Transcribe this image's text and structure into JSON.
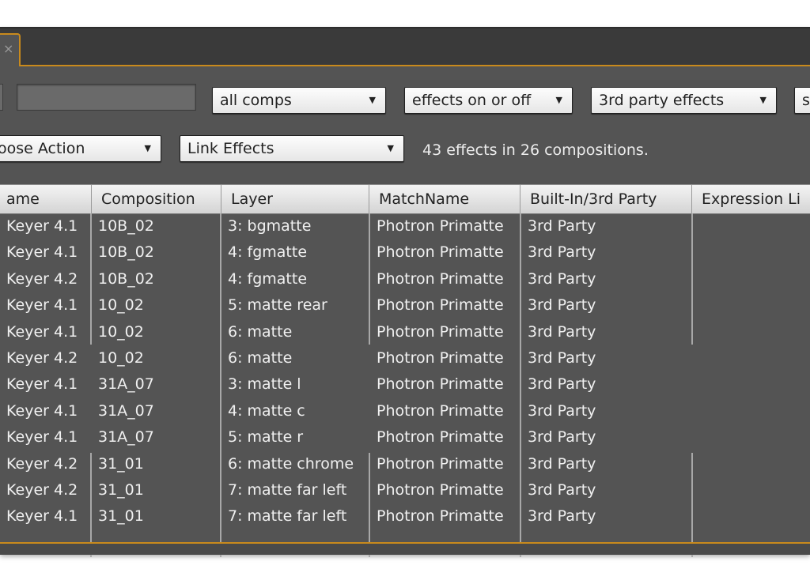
{
  "tab": {
    "close_glyph": "×"
  },
  "toolbar": {
    "search_value": "",
    "comp_filter": "all comps",
    "effects_state": "effects on or off",
    "effects_type": "3rd party effects",
    "partial_next": "s",
    "action_select": "oose Action",
    "action_type": "Link Effects",
    "status": "43 effects in 26 compositions.",
    "dropdown_arrow": "▼"
  },
  "table": {
    "headers": [
      "ame",
      "Composition",
      "Layer",
      "MatchName",
      "Built-In/3rd Party",
      "Expression Li"
    ],
    "rows": [
      [
        "Keyer 4.1",
        "10B_02",
        "3: bgmatte",
        "Photron Primatte",
        "3rd Party",
        ""
      ],
      [
        "Keyer 4.1",
        "10B_02",
        "4: fgmatte",
        "Photron Primatte",
        "3rd Party",
        ""
      ],
      [
        "Keyer 4.2",
        "10B_02",
        "4: fgmatte",
        "Photron Primatte",
        "3rd Party",
        ""
      ],
      [
        "Keyer 4.1",
        "10_02",
        "5: matte rear",
        "Photron Primatte",
        "3rd Party",
        ""
      ],
      [
        "Keyer 4.1",
        "10_02",
        "6: matte",
        "Photron Primatte",
        "3rd Party",
        ""
      ],
      [
        "Keyer 4.2",
        "10_02",
        "6: matte",
        "Photron Primatte",
        "3rd Party",
        ""
      ],
      [
        "Keyer 4.1",
        "31A_07",
        "3: matte l",
        "Photron Primatte",
        "3rd Party",
        ""
      ],
      [
        "Keyer 4.1",
        "31A_07",
        "4: matte c",
        "Photron Primatte",
        "3rd Party",
        ""
      ],
      [
        "Keyer 4.1",
        "31A_07",
        "5: matte r",
        "Photron Primatte",
        "3rd Party",
        ""
      ],
      [
        "Keyer 4.2",
        "31_01",
        "6: matte chrome",
        "Photron Primatte",
        "3rd Party",
        ""
      ],
      [
        "Keyer 4.2",
        "31_01",
        "7: matte far left",
        "Photron Primatte",
        "3rd Party",
        ""
      ],
      [
        "Keyer 4.1",
        "31_01",
        "7: matte far left",
        "Photron Primatte",
        "3rd Party",
        ""
      ]
    ]
  }
}
